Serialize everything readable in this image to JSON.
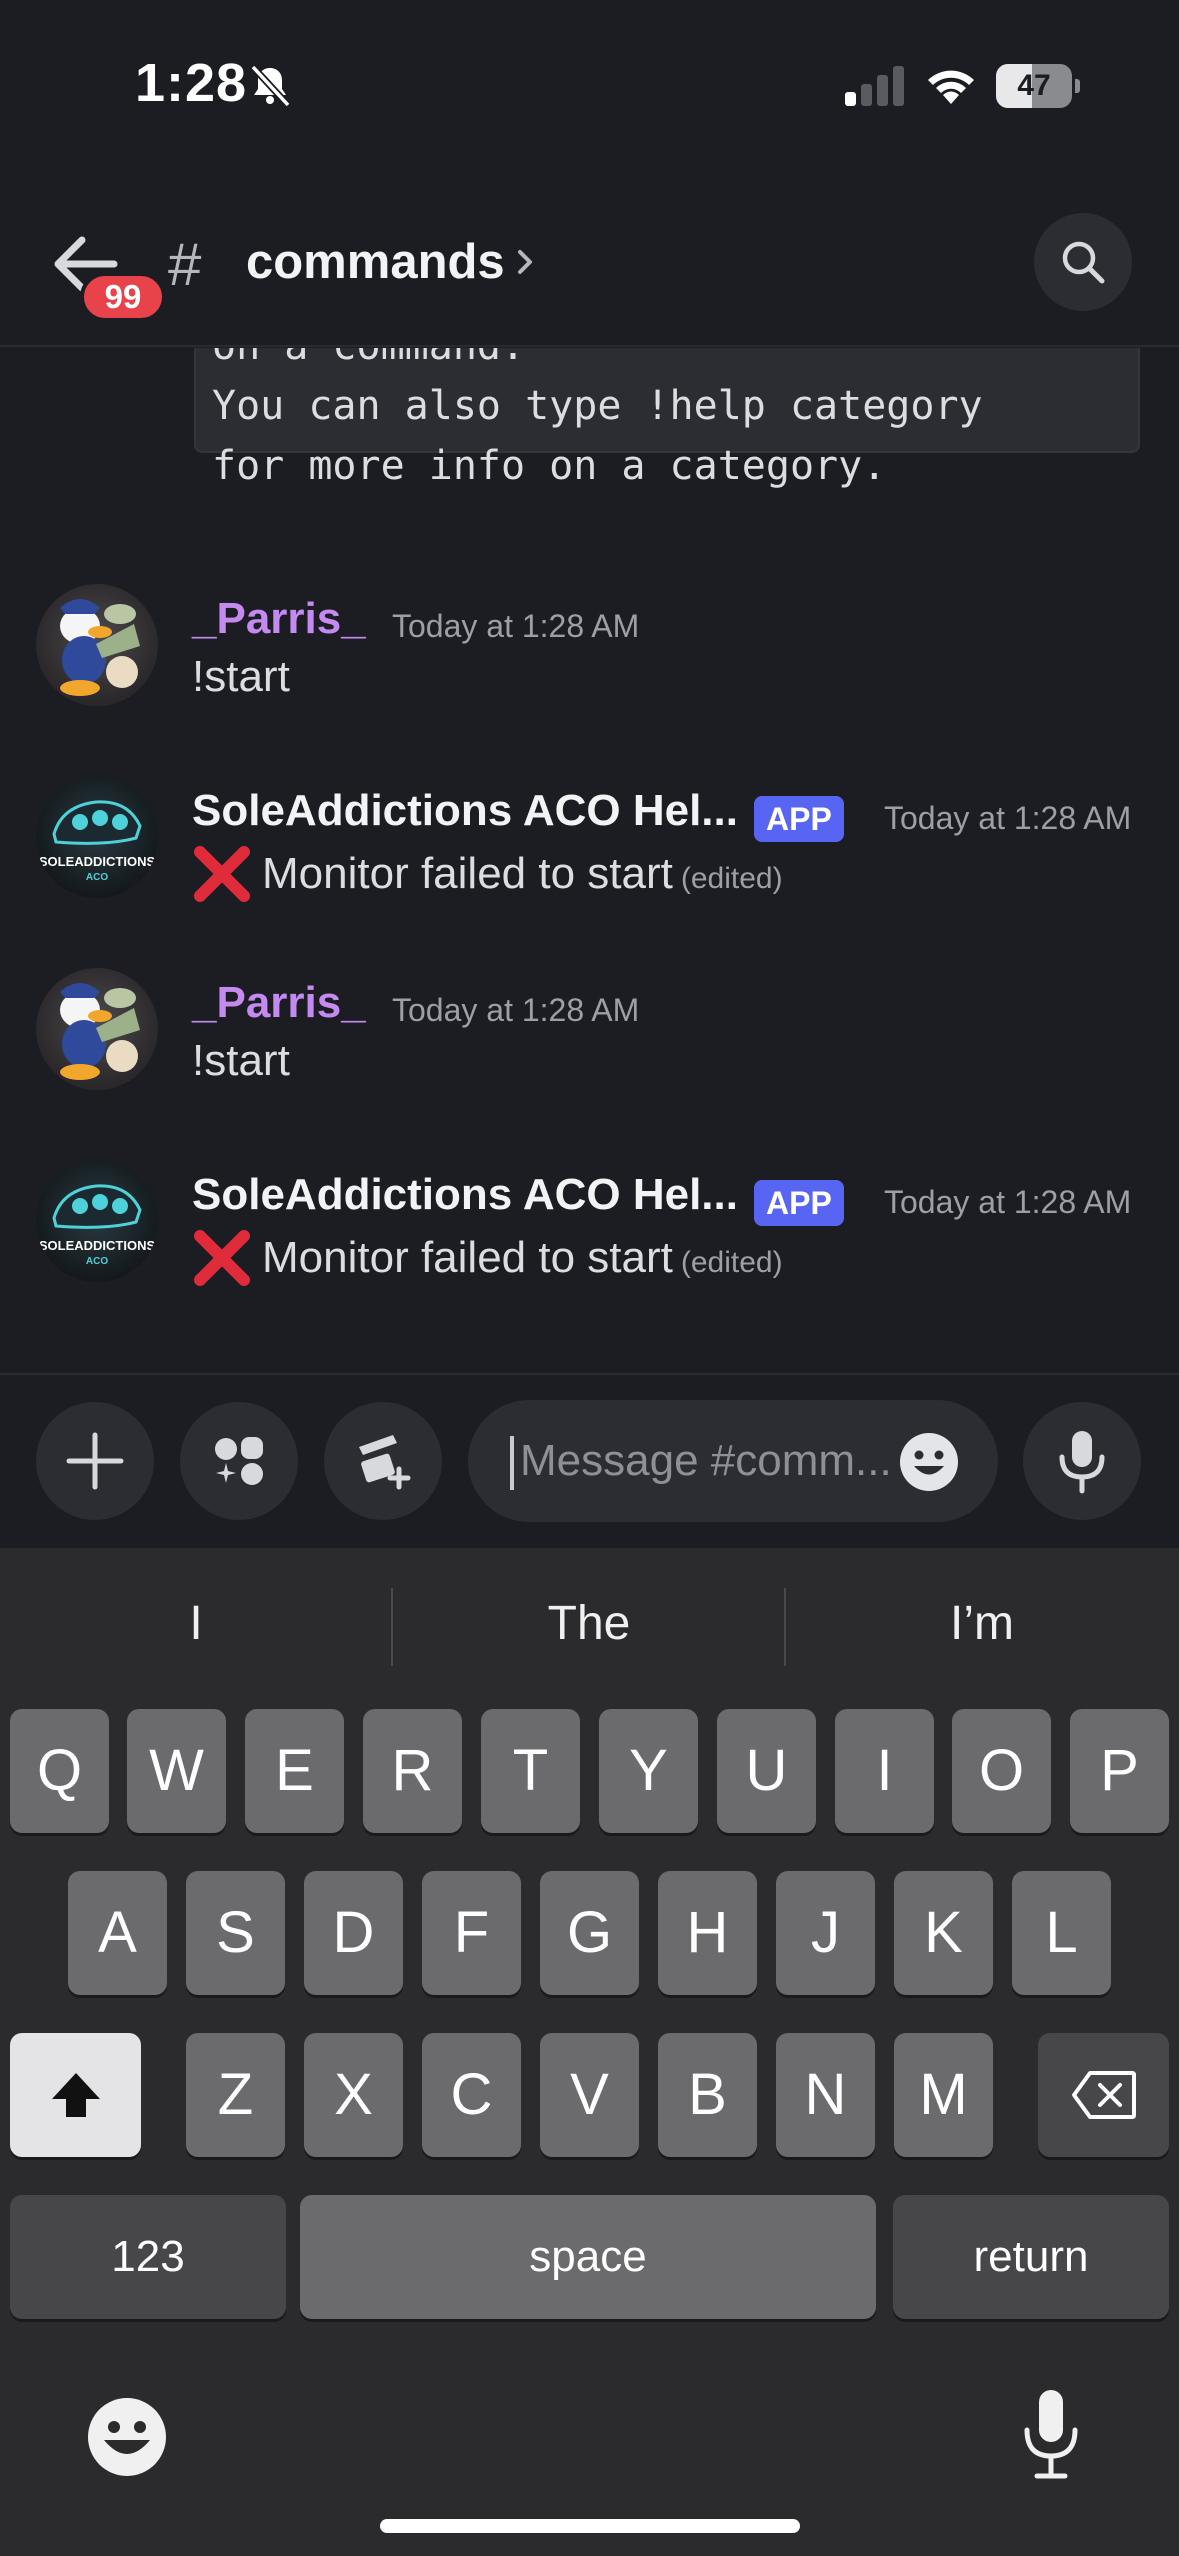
{
  "status_bar": {
    "time": "1:28",
    "battery": "47",
    "battery_fraction": 0.47,
    "icons": [
      "bell-slash-icon",
      "cellular-signal-icon",
      "wifi-icon",
      "battery-icon"
    ]
  },
  "header": {
    "unread_badge": "99",
    "channel_prefix": "#",
    "channel_name": "commands",
    "icons": [
      "back-arrow-icon",
      "chevron-right-icon",
      "search-icon"
    ]
  },
  "messages": {
    "code_block_lines": [
      "on a command.",
      "You can also type !help category",
      "for more info on a category."
    ],
    "items": [
      {
        "author": "_Parris_",
        "role": "user",
        "timestamp": "Today at 1:28 AM",
        "text": "!start"
      },
      {
        "author": "SoleAddictions ACO Hel...",
        "role": "bot",
        "tag": "APP",
        "timestamp": "Today at 1:28 AM",
        "text": "Monitor failed to start",
        "edited": "(edited)",
        "emoji": "cross-mark-icon"
      },
      {
        "author": "_Parris_",
        "role": "user",
        "timestamp": "Today at 1:28 AM",
        "text": "!start"
      },
      {
        "author": "SoleAddictions ACO Hel...",
        "role": "bot",
        "tag": "APP",
        "timestamp": "Today at 1:28 AM",
        "text": "Monitor failed to start",
        "edited": "(edited)",
        "emoji": "cross-mark-icon"
      }
    ],
    "bot_avatar_text": "SOLEADDICTIONS",
    "bot_avatar_subtext": "ACO"
  },
  "composer": {
    "placeholder": "Message #comm...",
    "icons": [
      "plus-icon",
      "apps-icon",
      "gift-nitro-icon",
      "emoji-icon",
      "microphone-icon"
    ]
  },
  "keyboard": {
    "predictions": [
      "I",
      "The",
      "I’m"
    ],
    "row1": [
      "Q",
      "W",
      "E",
      "R",
      "T",
      "Y",
      "U",
      "I",
      "O",
      "P"
    ],
    "row2": [
      "A",
      "S",
      "D",
      "F",
      "G",
      "H",
      "J",
      "K",
      "L"
    ],
    "row3": [
      "Z",
      "X",
      "C",
      "V",
      "B",
      "N",
      "M"
    ],
    "numbers_key": "123",
    "space_key": "space",
    "return_key": "return",
    "icons": [
      "shift-icon",
      "delete-icon",
      "emoji-keyboard-icon",
      "dictation-icon"
    ]
  },
  "colors": {
    "background": "#1c1d22",
    "username_purple": "#c58af2",
    "app_tag": "#5865f2",
    "badge_red": "#e8434b",
    "keyboard": "#2b2b2d",
    "key": "#6b6b6e"
  }
}
